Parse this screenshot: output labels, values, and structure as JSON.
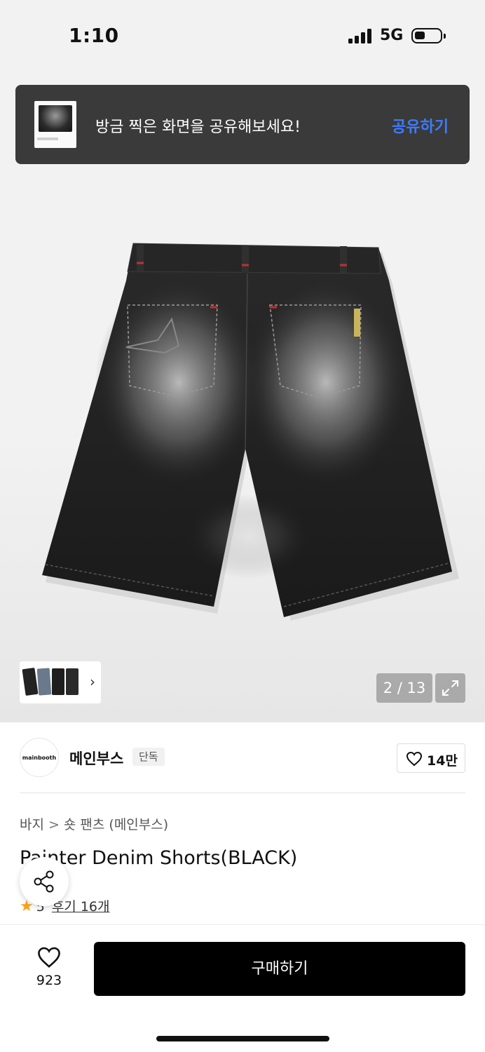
{
  "status_bar": {
    "time": "1:10",
    "network": "5G"
  },
  "share_banner": {
    "message": "방금 찍은 화면을 공유해보세요!",
    "action": "공유하기"
  },
  "gallery": {
    "current": "2 / 13"
  },
  "brand": {
    "logo_text": "mainbooth",
    "name": "메인부스",
    "badge": "단독",
    "likes": "14만"
  },
  "breadcrumb": {
    "category": "바지",
    "separator": ">",
    "subcategory": "숏 팬츠 (메인부스)"
  },
  "product": {
    "title": "Painter Denim Shorts(BLACK)",
    "rating": "5",
    "reviews": "후기 16개"
  },
  "bottom_bar": {
    "wish_count": "923",
    "buy_label": "구매하기"
  },
  "colors": {
    "accent": "#3d7cff",
    "star": "#ff9f1a",
    "banner_bg": "#3a3a3a",
    "buy_bg": "#000000"
  },
  "icons": [
    "heart-icon",
    "share-icon",
    "expand-icon",
    "chevron-right-icon",
    "star-icon"
  ]
}
